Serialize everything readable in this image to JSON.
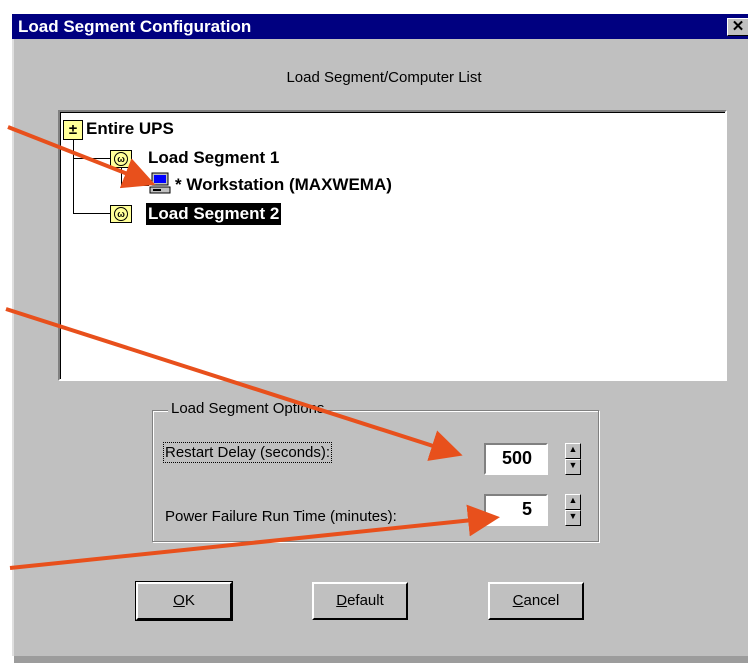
{
  "window": {
    "title": "Load Segment Configuration",
    "close_glyph": "✕"
  },
  "list_title": "Load Segment/Computer List",
  "tree": {
    "root": {
      "label": "Entire UPS",
      "icon": "plus-box-icon"
    },
    "segment1": {
      "label": "Load Segment 1",
      "icon": "outlet-folder-icon"
    },
    "workstation": {
      "label": "* Workstation (MAXWEMA)",
      "icon": "computer-icon"
    },
    "segment2": {
      "label": "Load Segment 2",
      "icon": "outlet-folder-icon",
      "selected": true
    }
  },
  "options": {
    "legend": "Load Segment Options",
    "restart_delay": {
      "label": "Restart Delay (seconds):",
      "value": "500"
    },
    "run_time": {
      "label": "Power Failure Run Time (minutes):",
      "value": "5"
    }
  },
  "buttons": {
    "ok": {
      "mnemonic": "O",
      "rest": "K"
    },
    "default": {
      "mnemonic": "D",
      "rest": "efault"
    },
    "cancel": {
      "mnemonic": "C",
      "rest": "ancel"
    }
  },
  "colors": {
    "titlebar": "#000080",
    "dialog": "#c0c0c0",
    "annotation_arrow": "#e8501c",
    "folder": "#ffff99"
  }
}
